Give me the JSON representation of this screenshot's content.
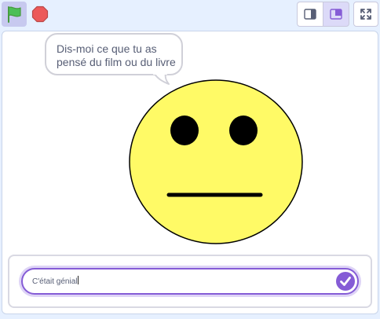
{
  "toolbar": {
    "green_flag_icon": "green-flag-icon",
    "stop_icon": "stop-sign-icon",
    "small_stage_icon": "small-stage-layout-icon",
    "normal_stage_icon": "normal-stage-layout-icon",
    "fullscreen_icon": "fullscreen-icon",
    "selected_layout": "normal-stage"
  },
  "stage": {
    "speech_bubble": {
      "line1": "Dis-moi ce que tu as",
      "line2": "pensé du film ou du livre"
    },
    "sprite": {
      "name": "neutral-face",
      "fill": "#fffa66",
      "stroke": "#000000"
    }
  },
  "ask_prompt": {
    "value": "C'était génial",
    "submit_icon": "checkmark-icon"
  },
  "colors": {
    "accent": "#855cd6",
    "flag_green": "#4cbf56",
    "stop_red": "#ec5959",
    "background": "#e6f0ff"
  }
}
